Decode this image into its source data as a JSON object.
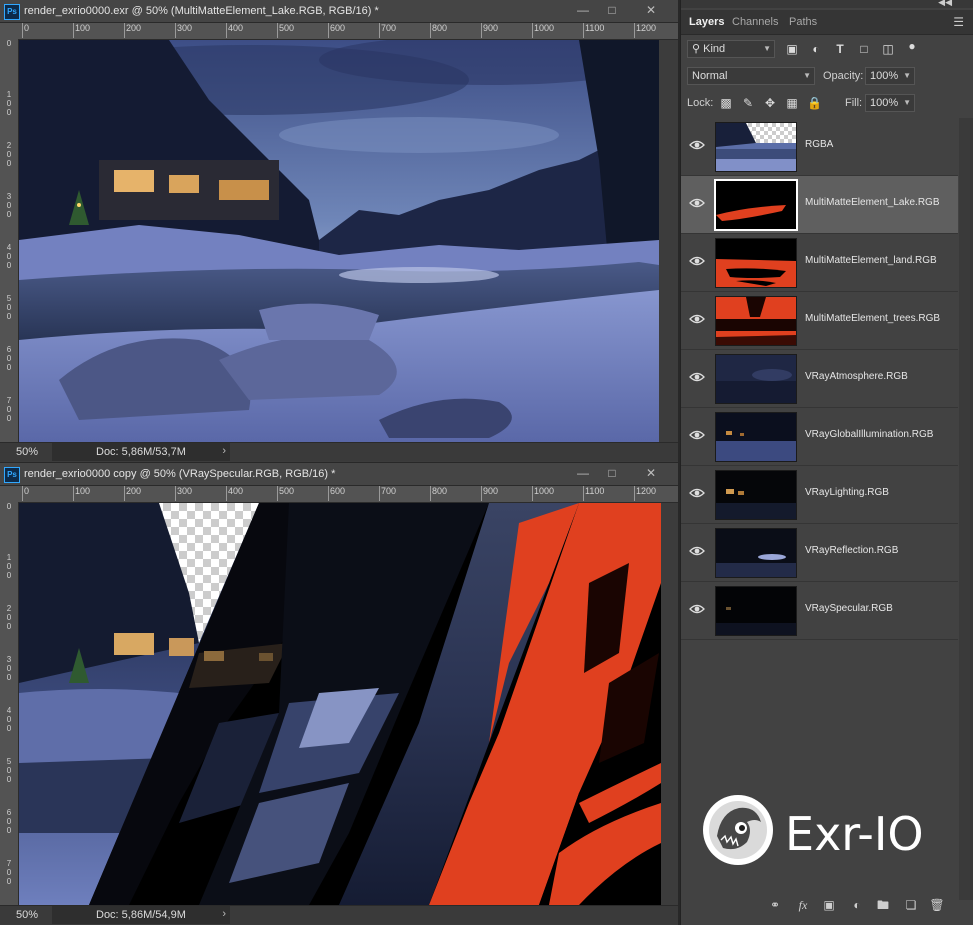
{
  "doc1": {
    "title": "render_exrio0000.exr @ 50% (MultiMatteElement_Lake.RGB, RGB/16) *",
    "zoom": "50%",
    "doc_size": "Doc: 5,86M/53,7M"
  },
  "doc2": {
    "title": "render_exrio0000 copy @ 50% (VRaySpecular.RGB, RGB/16) *",
    "zoom": "50%",
    "doc_size": "Doc: 5,86M/54,9M"
  },
  "ruler": {
    "h_ticks": [
      "0",
      "100",
      "200",
      "300",
      "400",
      "500",
      "600",
      "700",
      "800",
      "900",
      "1000",
      "1100",
      "1200"
    ],
    "v_ticks1": [
      "0",
      "100",
      "200",
      "300",
      "400",
      "500",
      "600",
      "700"
    ],
    "v_ticks2": [
      "0",
      "100",
      "200",
      "300",
      "400",
      "500",
      "600",
      "700",
      "800"
    ]
  },
  "panel": {
    "tabs": [
      "Layers",
      "Channels",
      "Paths"
    ],
    "filter_kind": "Kind",
    "blend_mode": "Normal",
    "opacity_label": "Opacity:",
    "opacity_value": "100%",
    "lock_label": "Lock:",
    "fill_label": "Fill:",
    "fill_value": "100%"
  },
  "layers": [
    {
      "name": "RGBA",
      "selected": false
    },
    {
      "name": "MultiMatteElement_Lake.RGB",
      "selected": true
    },
    {
      "name": "MultiMatteElement_land.RGB",
      "selected": false
    },
    {
      "name": "MultiMatteElement_trees.RGB",
      "selected": false
    },
    {
      "name": "VRayAtmosphere.RGB",
      "selected": false
    },
    {
      "name": "VRayGlobalIllumination.RGB",
      "selected": false
    },
    {
      "name": "VRayLighting.RGB",
      "selected": false
    },
    {
      "name": "VRayReflection.RGB",
      "selected": false
    },
    {
      "name": "VRaySpecular.RGB",
      "selected": false
    }
  ],
  "logo": {
    "text": "Exr-IO"
  },
  "colors": {
    "matte_red": "#e0401f",
    "ps_blue": "#31a8ff",
    "selection": "#5f5f5f"
  }
}
